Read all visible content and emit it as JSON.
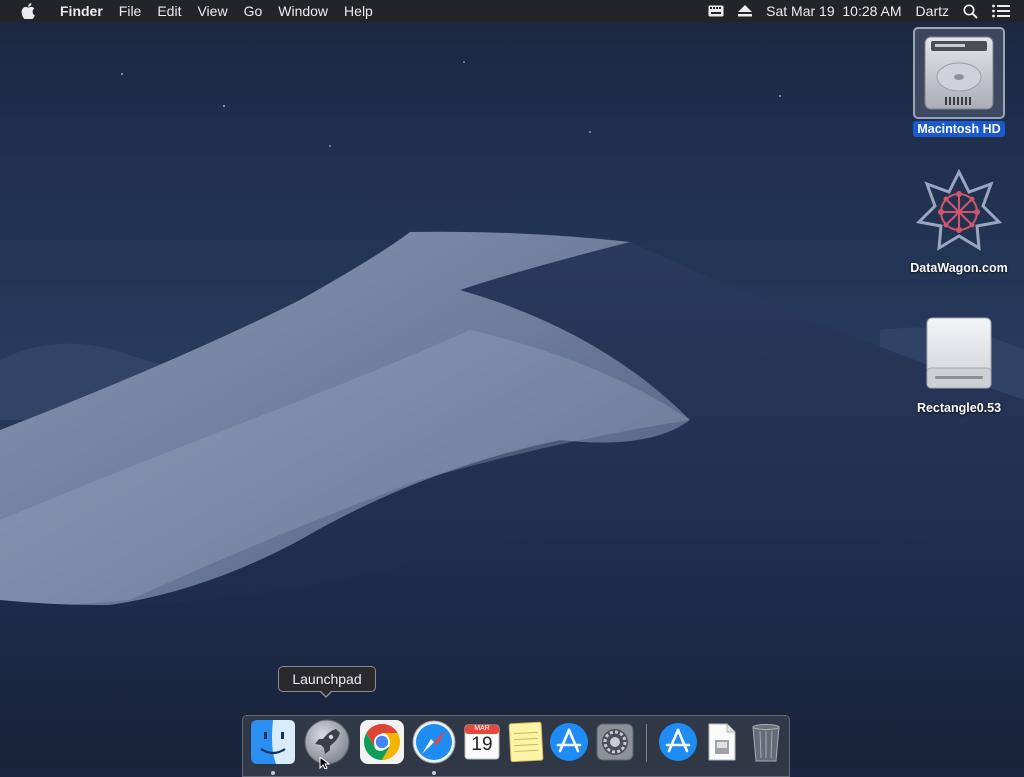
{
  "menubar": {
    "app_name": "Finder",
    "menus": [
      "File",
      "Edit",
      "View",
      "Go",
      "Window",
      "Help"
    ],
    "status": {
      "date_time": "Sat Mar 19  10:28 AM",
      "user": "Dartz",
      "icons": [
        "keyboard-icon",
        "eject-icon",
        "spotlight-search-icon",
        "notification-center-icon"
      ]
    }
  },
  "desktop": {
    "icons": [
      {
        "label": "Macintosh HD",
        "icon": "hard-drive-icon",
        "selected": true
      },
      {
        "label": "DataWagon.com",
        "icon": "datawagon-logo-icon",
        "selected": false
      },
      {
        "label": "Rectangle0.53",
        "icon": "external-disk-icon",
        "selected": false
      }
    ]
  },
  "dock": {
    "tooltip": "Launchpad",
    "calendar_month": "MAR",
    "calendar_day": "19",
    "apps": [
      {
        "icon": "finder-icon",
        "running": true
      },
      {
        "icon": "launchpad-icon",
        "running": false
      },
      {
        "icon": "chrome-icon",
        "running": false
      },
      {
        "icon": "safari-icon",
        "running": true
      },
      {
        "icon": "calendar-icon",
        "running": false
      },
      {
        "icon": "notes-icon",
        "running": false
      },
      {
        "icon": "app-store-icon",
        "running": false
      },
      {
        "icon": "system-preferences-icon",
        "running": false
      },
      {
        "icon": "app-store-downloads-icon",
        "running": false
      },
      {
        "icon": "document-icon",
        "running": false
      },
      {
        "icon": "trash-icon",
        "running": false
      }
    ]
  },
  "colors": {
    "menubar_bg": "#222428",
    "selection_blue": "#1b59d3",
    "wallpaper_sky": "#1d2a45"
  }
}
